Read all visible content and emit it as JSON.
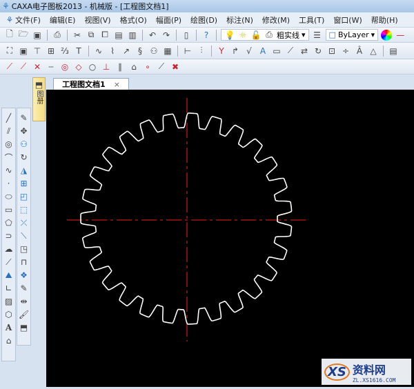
{
  "window": {
    "title": "CAXA电子图板2013 - 机械版 - [工程图文档1]"
  },
  "menu": [
    "文件(F)",
    "编辑(E)",
    "视图(V)",
    "格式(O)",
    "幅面(P)",
    "绘图(D)",
    "标注(N)",
    "修改(M)",
    "工具(T)",
    "窗口(W)",
    "帮助(H)"
  ],
  "toolbar": {
    "linetype": "粗实线",
    "color": "ByLayer"
  },
  "tabs": [
    {
      "label": "工程图文档1",
      "close": "×"
    }
  ],
  "side_tab": {
    "label": "图册"
  },
  "drawing": {
    "gear_teeth": 27,
    "gear_color": "#ffffff",
    "centerline_color": "#c01818",
    "background": "#000000"
  },
  "watermark": {
    "logo": "XS",
    "name": "资料网",
    "url": "ZL.XS1616.COM"
  }
}
